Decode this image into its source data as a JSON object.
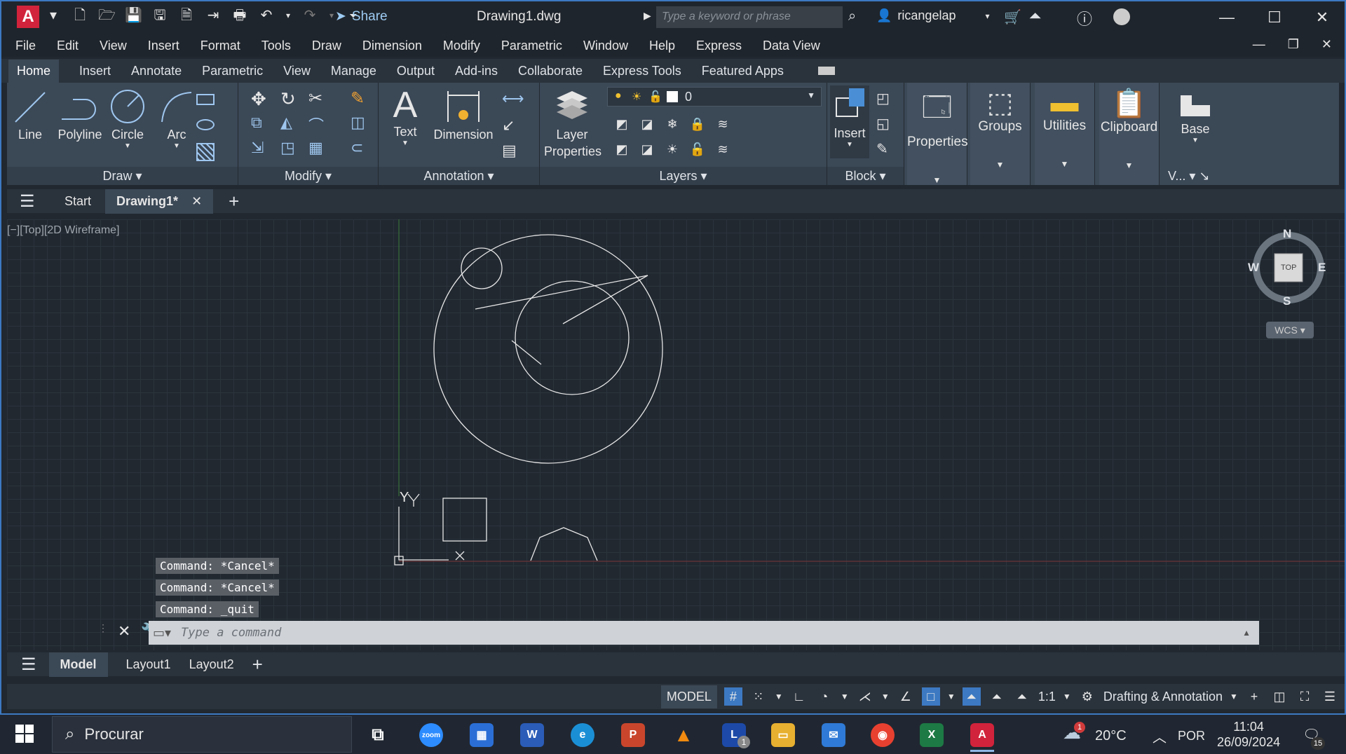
{
  "window": {
    "logo_letter": "A",
    "share_label": "Share",
    "title": "Drawing1.dwg",
    "search_placeholder": "Type a keyword or phrase",
    "username": "ricangelap"
  },
  "menu": [
    "File",
    "Edit",
    "View",
    "Insert",
    "Format",
    "Tools",
    "Draw",
    "Dimension",
    "Modify",
    "Parametric",
    "Window",
    "Help",
    "Express",
    "Data View"
  ],
  "ribbon_tabs": [
    "Home",
    "Insert",
    "Annotate",
    "Parametric",
    "View",
    "Manage",
    "Output",
    "Add-ins",
    "Collaborate",
    "Express Tools",
    "Featured Apps"
  ],
  "ribbon": {
    "draw": {
      "title": "Draw",
      "line": "Line",
      "polyline": "Polyline",
      "circle": "Circle",
      "arc": "Arc"
    },
    "modify": {
      "title": "Modify"
    },
    "annotation": {
      "title": "Annotation",
      "text": "Text",
      "dimension": "Dimension"
    },
    "layers": {
      "title": "Layers",
      "layer_properties": "Layer\nProperties",
      "current_layer": "0"
    },
    "block": {
      "title": "Block",
      "insert": "Insert"
    },
    "properties": "Properties",
    "groups": "Groups",
    "utilities": "Utilities",
    "clipboard": "Clipboard",
    "base": "Base",
    "view_short": "V..."
  },
  "file_tabs": {
    "start": "Start",
    "drawing": "Drawing1*"
  },
  "viewport": {
    "label": "[−][Top][2D Wireframe]",
    "compass": {
      "n": "N",
      "s": "S",
      "e": "E",
      "w": "W",
      "top": "TOP"
    },
    "wcs": "WCS",
    "ucs_y": "Y",
    "ucs_x": "X"
  },
  "command_history": [
    "Command: *Cancel*",
    "Command: *Cancel*",
    "Command: _quit"
  ],
  "command_placeholder": "Type a command",
  "layout_tabs": {
    "model": "Model",
    "layout1": "Layout1",
    "layout2": "Layout2"
  },
  "status": {
    "model": "MODEL",
    "scale": "1:1",
    "workspace": "Drafting & Annotation"
  },
  "taskbar": {
    "search": "Procurar",
    "weather": "20°C",
    "language": "POR",
    "time": "11:04",
    "date": "26/09/2024",
    "notifications": "15",
    "weather_badge": "1",
    "l_badge": "1"
  },
  "colors": {
    "accent": "#3c79c2",
    "autocad_red": "#d1233b",
    "share_blue": "#9dcbf2"
  }
}
